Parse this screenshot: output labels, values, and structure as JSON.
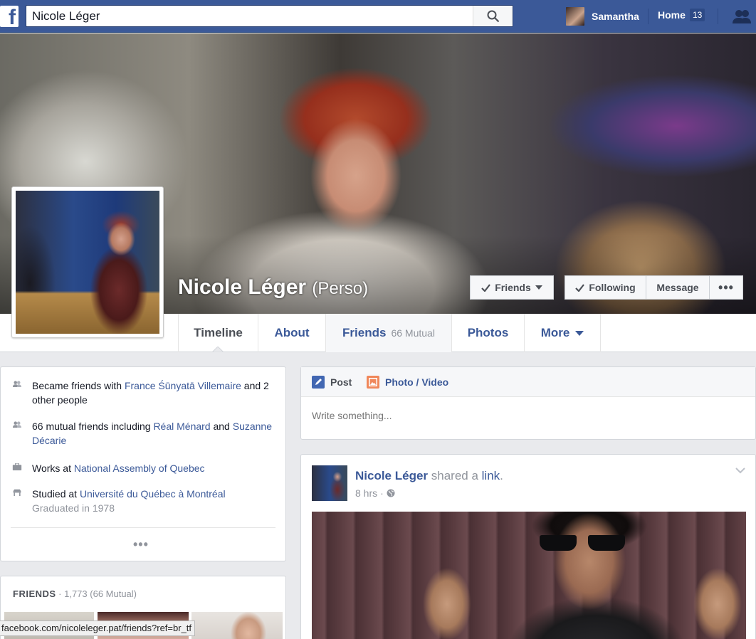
{
  "topbar": {
    "logo": "f",
    "search_value": "Nicole Léger",
    "user_name": "Samantha",
    "home_label": "Home",
    "home_count": "13",
    "accent": "#3b5998"
  },
  "profile": {
    "name": "Nicole Léger",
    "alt_name": "(Perso)"
  },
  "cover_buttons": {
    "friends": "Friends",
    "following": "Following",
    "message": "Message",
    "more": "•••"
  },
  "nav": {
    "timeline": "Timeline",
    "about": "About",
    "friends": "Friends",
    "friends_mutual": "66 Mutual",
    "photos": "Photos",
    "more": "More"
  },
  "intro": {
    "row1": {
      "prefix": "Became friends with ",
      "link": "France Śūnyatā Villemaire",
      "suffix": " and 2 other people"
    },
    "row2": {
      "prefix": "66 mutual friends including ",
      "link1": "Réal Ménard",
      "mid": " and ",
      "link2": "Suzanne Décarie"
    },
    "row3": {
      "prefix": "Works at ",
      "link": "National Assembly of Quebec"
    },
    "row4": {
      "prefix": "Studied at ",
      "link": "Université du Québec à Montréal",
      "sub": "Graduated in 1978"
    },
    "more": "•••"
  },
  "friends_card": {
    "label": "FRIENDS",
    "count": " · 1,773 (66 Mutual)"
  },
  "status_url": "facebook.com/nicoleleger.pat/friends?ref=br_tf",
  "composer": {
    "post_tab": "Post",
    "photo_tab": "Photo / Video",
    "placeholder": "Write something..."
  },
  "post": {
    "author": "Nicole Léger",
    "action": " shared a ",
    "object": "link",
    "tail": ".",
    "time": "8 hrs",
    "dot": "·"
  },
  "icons": [
    "facebook-logo-icon",
    "search-icon",
    "friend-requests-icon",
    "checkmark-icon",
    "caret-down-icon",
    "people-icon",
    "briefcase-icon",
    "school-icon",
    "pencil-icon",
    "photo-icon",
    "globe-icon",
    "chevron-down-icon"
  ]
}
